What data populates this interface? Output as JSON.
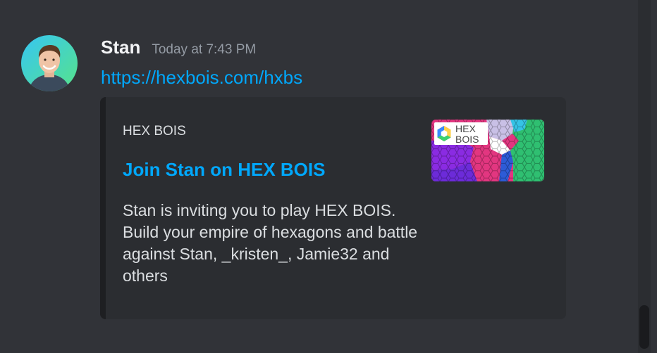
{
  "message": {
    "author": "Stan",
    "timestamp": "Today at 7:43 PM",
    "link_text": "https://hexbois.com/hxbs"
  },
  "embed": {
    "provider": "HEX BOIS",
    "title": "Join Stan on HEX BOIS",
    "description": "Stan is inviting you to play HEX BOIS. Build your empire of hexagons and battle against Stan, _kristen_, Jamie32 and others",
    "thumbnail_logo_text": "HEX BOIS"
  },
  "colors": {
    "background": "#313338",
    "link": "#00a8fc",
    "embed_background": "#2b2d31",
    "text": "#dbdee1",
    "muted": "#949ba4"
  },
  "icons": [
    "avatar-photo",
    "hex-bois-logo"
  ]
}
